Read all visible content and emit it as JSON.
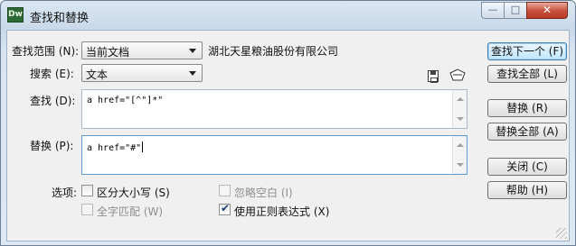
{
  "window": {
    "app_icon_text": "Dw",
    "title": "查找和替换",
    "controls": {
      "minimize": "—",
      "maximize": "□",
      "close": "✕"
    }
  },
  "scope": {
    "label": "查找范围 (N):",
    "value": "当前文档",
    "context_text": "湖北天星粮油股份有限公司"
  },
  "search_type": {
    "label": "搜索 (E):",
    "value": "文本"
  },
  "find": {
    "label": "查找 (D):",
    "value": "a href=\"[^\"]*\""
  },
  "replace": {
    "label": "替换 (P):",
    "value": "a href=\"#\""
  },
  "options": {
    "label": "选项:",
    "case_sensitive": {
      "label": "区分大小写 (S)",
      "checked": false,
      "enabled": true
    },
    "ignore_whitespace": {
      "label": "忽略空白 (I)",
      "checked": false,
      "enabled": false
    },
    "whole_word": {
      "label": "全字匹配 (W)",
      "checked": false,
      "enabled": false
    },
    "use_regex": {
      "label": "使用正则表达式 (X)",
      "checked": true,
      "enabled": true
    }
  },
  "buttons": {
    "find_next": "查找下一个 (F)",
    "find_all": "查找全部 (L)",
    "replace": "替换 (R)",
    "replace_all": "替换全部 (A)",
    "close": "关闭 (C)",
    "help": "帮助 (H)"
  },
  "icons": {
    "save": "save-query-icon",
    "open": "load-query-icon"
  }
}
